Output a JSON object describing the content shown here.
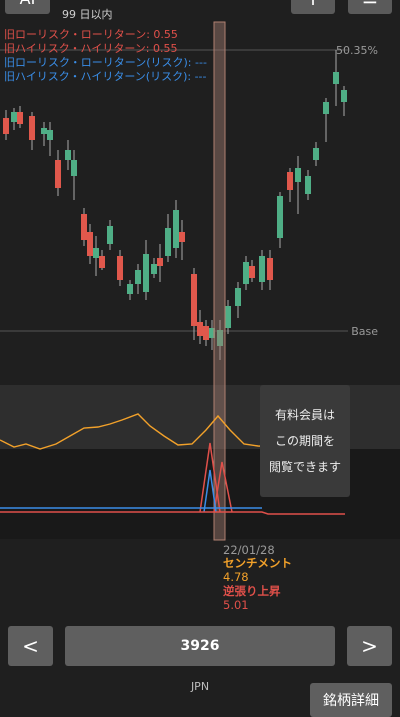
{
  "header": {
    "left_button_label": "AI",
    "period_label": "99 日以内",
    "plus_label": "+",
    "menu_label": "≡"
  },
  "legend": [
    {
      "text": "旧ローリスク・ローリターン: 0.55",
      "color": "#e0504a"
    },
    {
      "text": "旧ハイリスク・ハイリターン: 0.55",
      "color": "#e0504a"
    },
    {
      "text": "旧ローリスク・ローリターン(リスク): ---",
      "color": "#3a8ee8"
    },
    {
      "text": "旧ハイリスク・ハイリターン(リスク): ---",
      "color": "#3a8ee8"
    }
  ],
  "axis": {
    "top_label": "50.35%",
    "base_label": "Base"
  },
  "paywall": {
    "line1": "有料会員は",
    "line2": "この期間を",
    "line3": "閲覧できます"
  },
  "info": {
    "date": "22/01/28",
    "sentiment_label": "センチメント",
    "sentiment_value": "4.78",
    "contrarian_label": "逆張り上昇",
    "contrarian_value": "5.01"
  },
  "nav": {
    "prev_label": "<",
    "code": "3926",
    "next_label": ">",
    "market": "JPN",
    "detail_button": "銘柄詳細"
  },
  "colors": {
    "up": "#4fae86",
    "down": "#e0584c",
    "sentiment": "#f2a12a",
    "red_line": "#e0504a",
    "blue_line": "#3a8ee8"
  }
}
